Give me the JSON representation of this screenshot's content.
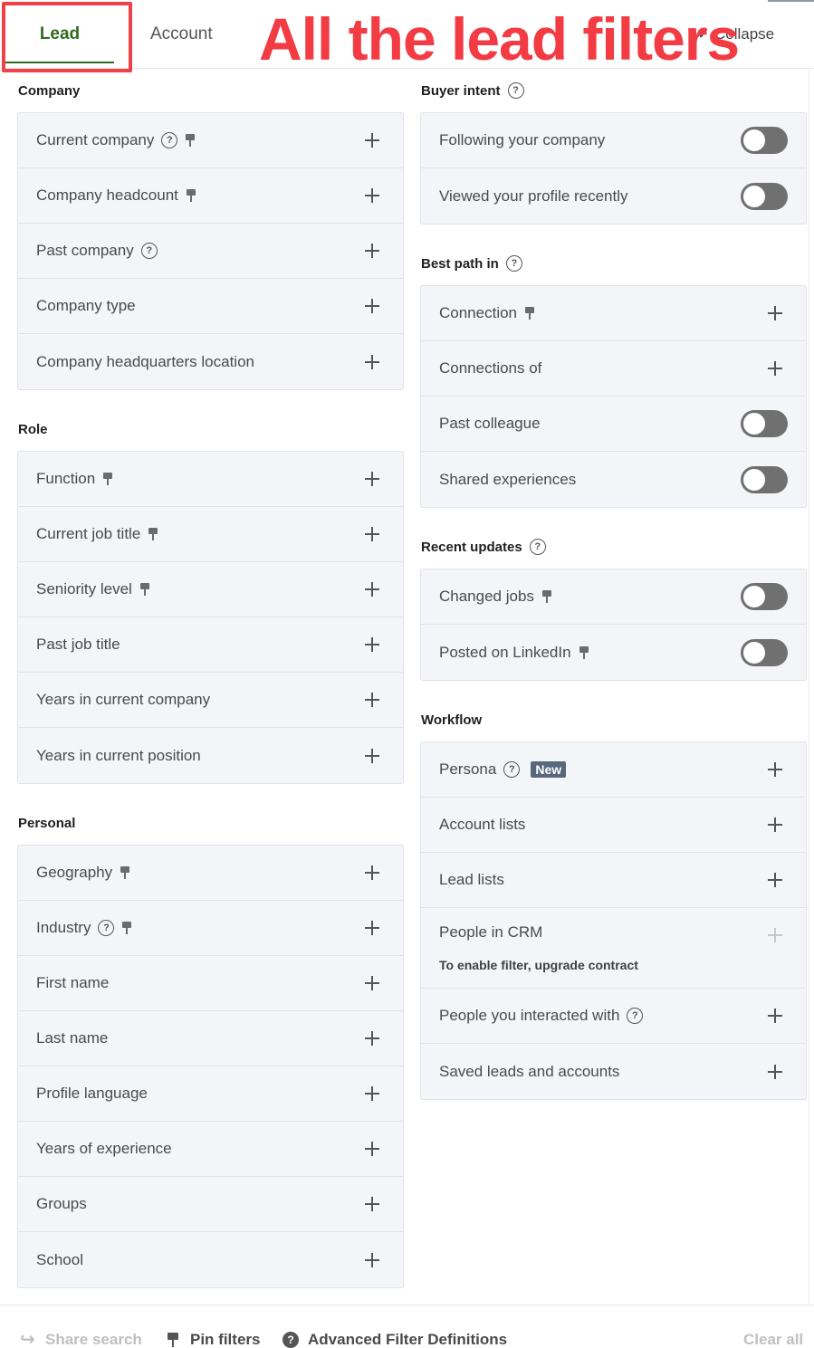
{
  "tabs": {
    "lead": "Lead",
    "account": "Account"
  },
  "collapse_label": "✓ Collapse",
  "annotation_text": "All the lead filters",
  "left": {
    "company": {
      "title": "Company",
      "items": [
        {
          "label": "Current company",
          "help": true,
          "pin": true
        },
        {
          "label": "Company headcount",
          "pin": true
        },
        {
          "label": "Past company",
          "help": true
        },
        {
          "label": "Company type"
        },
        {
          "label": "Company headquarters location"
        }
      ]
    },
    "role": {
      "title": "Role",
      "items": [
        {
          "label": "Function",
          "pin": true
        },
        {
          "label": "Current job title",
          "pin": true
        },
        {
          "label": "Seniority level",
          "pin": true
        },
        {
          "label": "Past job title"
        },
        {
          "label": "Years in current company"
        },
        {
          "label": "Years in current position"
        }
      ]
    },
    "personal": {
      "title": "Personal",
      "items": [
        {
          "label": "Geography",
          "pin": true
        },
        {
          "label": "Industry",
          "help": true,
          "pin": true
        },
        {
          "label": "First name"
        },
        {
          "label": "Last name"
        },
        {
          "label": "Profile language"
        },
        {
          "label": "Years of experience"
        },
        {
          "label": "Groups"
        },
        {
          "label": "School"
        }
      ]
    }
  },
  "right": {
    "buyer_intent": {
      "title": "Buyer intent",
      "items": [
        {
          "label": "Following your company",
          "toggle": "off"
        },
        {
          "label": "Viewed your profile recently",
          "toggle": "off"
        }
      ]
    },
    "best_path": {
      "title": "Best path in",
      "items": [
        {
          "label": "Connection",
          "pin": true
        },
        {
          "label": "Connections of"
        },
        {
          "label": "Past colleague",
          "toggle": "off"
        },
        {
          "label": "Shared experiences",
          "toggle": "off"
        }
      ]
    },
    "recent_updates": {
      "title": "Recent updates",
      "items": [
        {
          "label": "Changed jobs",
          "pin": true,
          "toggle": "off"
        },
        {
          "label": "Posted on LinkedIn",
          "pin": true,
          "toggle": "off"
        }
      ]
    },
    "workflow": {
      "title": "Workflow",
      "items": [
        {
          "label": "Persona",
          "help": true,
          "badge": "New"
        },
        {
          "label": "Account lists"
        },
        {
          "label": "Lead lists"
        },
        {
          "label": "People in CRM",
          "note": "To enable filter, upgrade contract",
          "disabled": true
        },
        {
          "label": "People you interacted with",
          "help": true
        },
        {
          "label": "Saved leads and accounts"
        }
      ]
    }
  },
  "footer": {
    "share": "Share search",
    "pin": "Pin filters",
    "advanced": "Advanced Filter Definitions",
    "clear": "Clear all"
  },
  "colors": {
    "accent": "#2f6b1f",
    "annotation": "#f23b43",
    "card_bg": "#f4f5f9",
    "toggle_off": "#707070"
  }
}
